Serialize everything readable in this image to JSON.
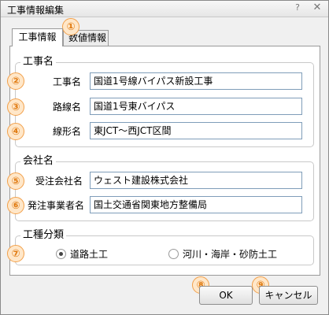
{
  "window": {
    "title": "工事情報編集",
    "help_glyph": "?"
  },
  "tabs": [
    {
      "label": "工事情報"
    },
    {
      "label": "数値情報"
    }
  ],
  "badges": [
    "①",
    "②",
    "③",
    "④",
    "⑤",
    "⑥",
    "⑦",
    "⑧",
    "⑨"
  ],
  "project_group": {
    "legend": "工事名",
    "fields": [
      {
        "label": "工事名",
        "value": "国道1号線バイパス新設工事"
      },
      {
        "label": "路線名",
        "value": "国道1号東バイパス"
      },
      {
        "label": "線形名",
        "value": "東JCT～西JCT区間"
      }
    ]
  },
  "company_group": {
    "legend": "会社名",
    "fields": [
      {
        "label": "受注会社名",
        "value": "ウェスト建設株式会社"
      },
      {
        "label": "発注事業者名",
        "value": "国土交通省関東地方整備局"
      }
    ]
  },
  "work_type_group": {
    "legend": "工種分類",
    "options": [
      {
        "label": "道路土工",
        "selected": true
      },
      {
        "label": "河川・海岸・砂防土工",
        "selected": false
      }
    ]
  },
  "buttons": {
    "ok": "OK",
    "cancel": "キャンセル"
  }
}
